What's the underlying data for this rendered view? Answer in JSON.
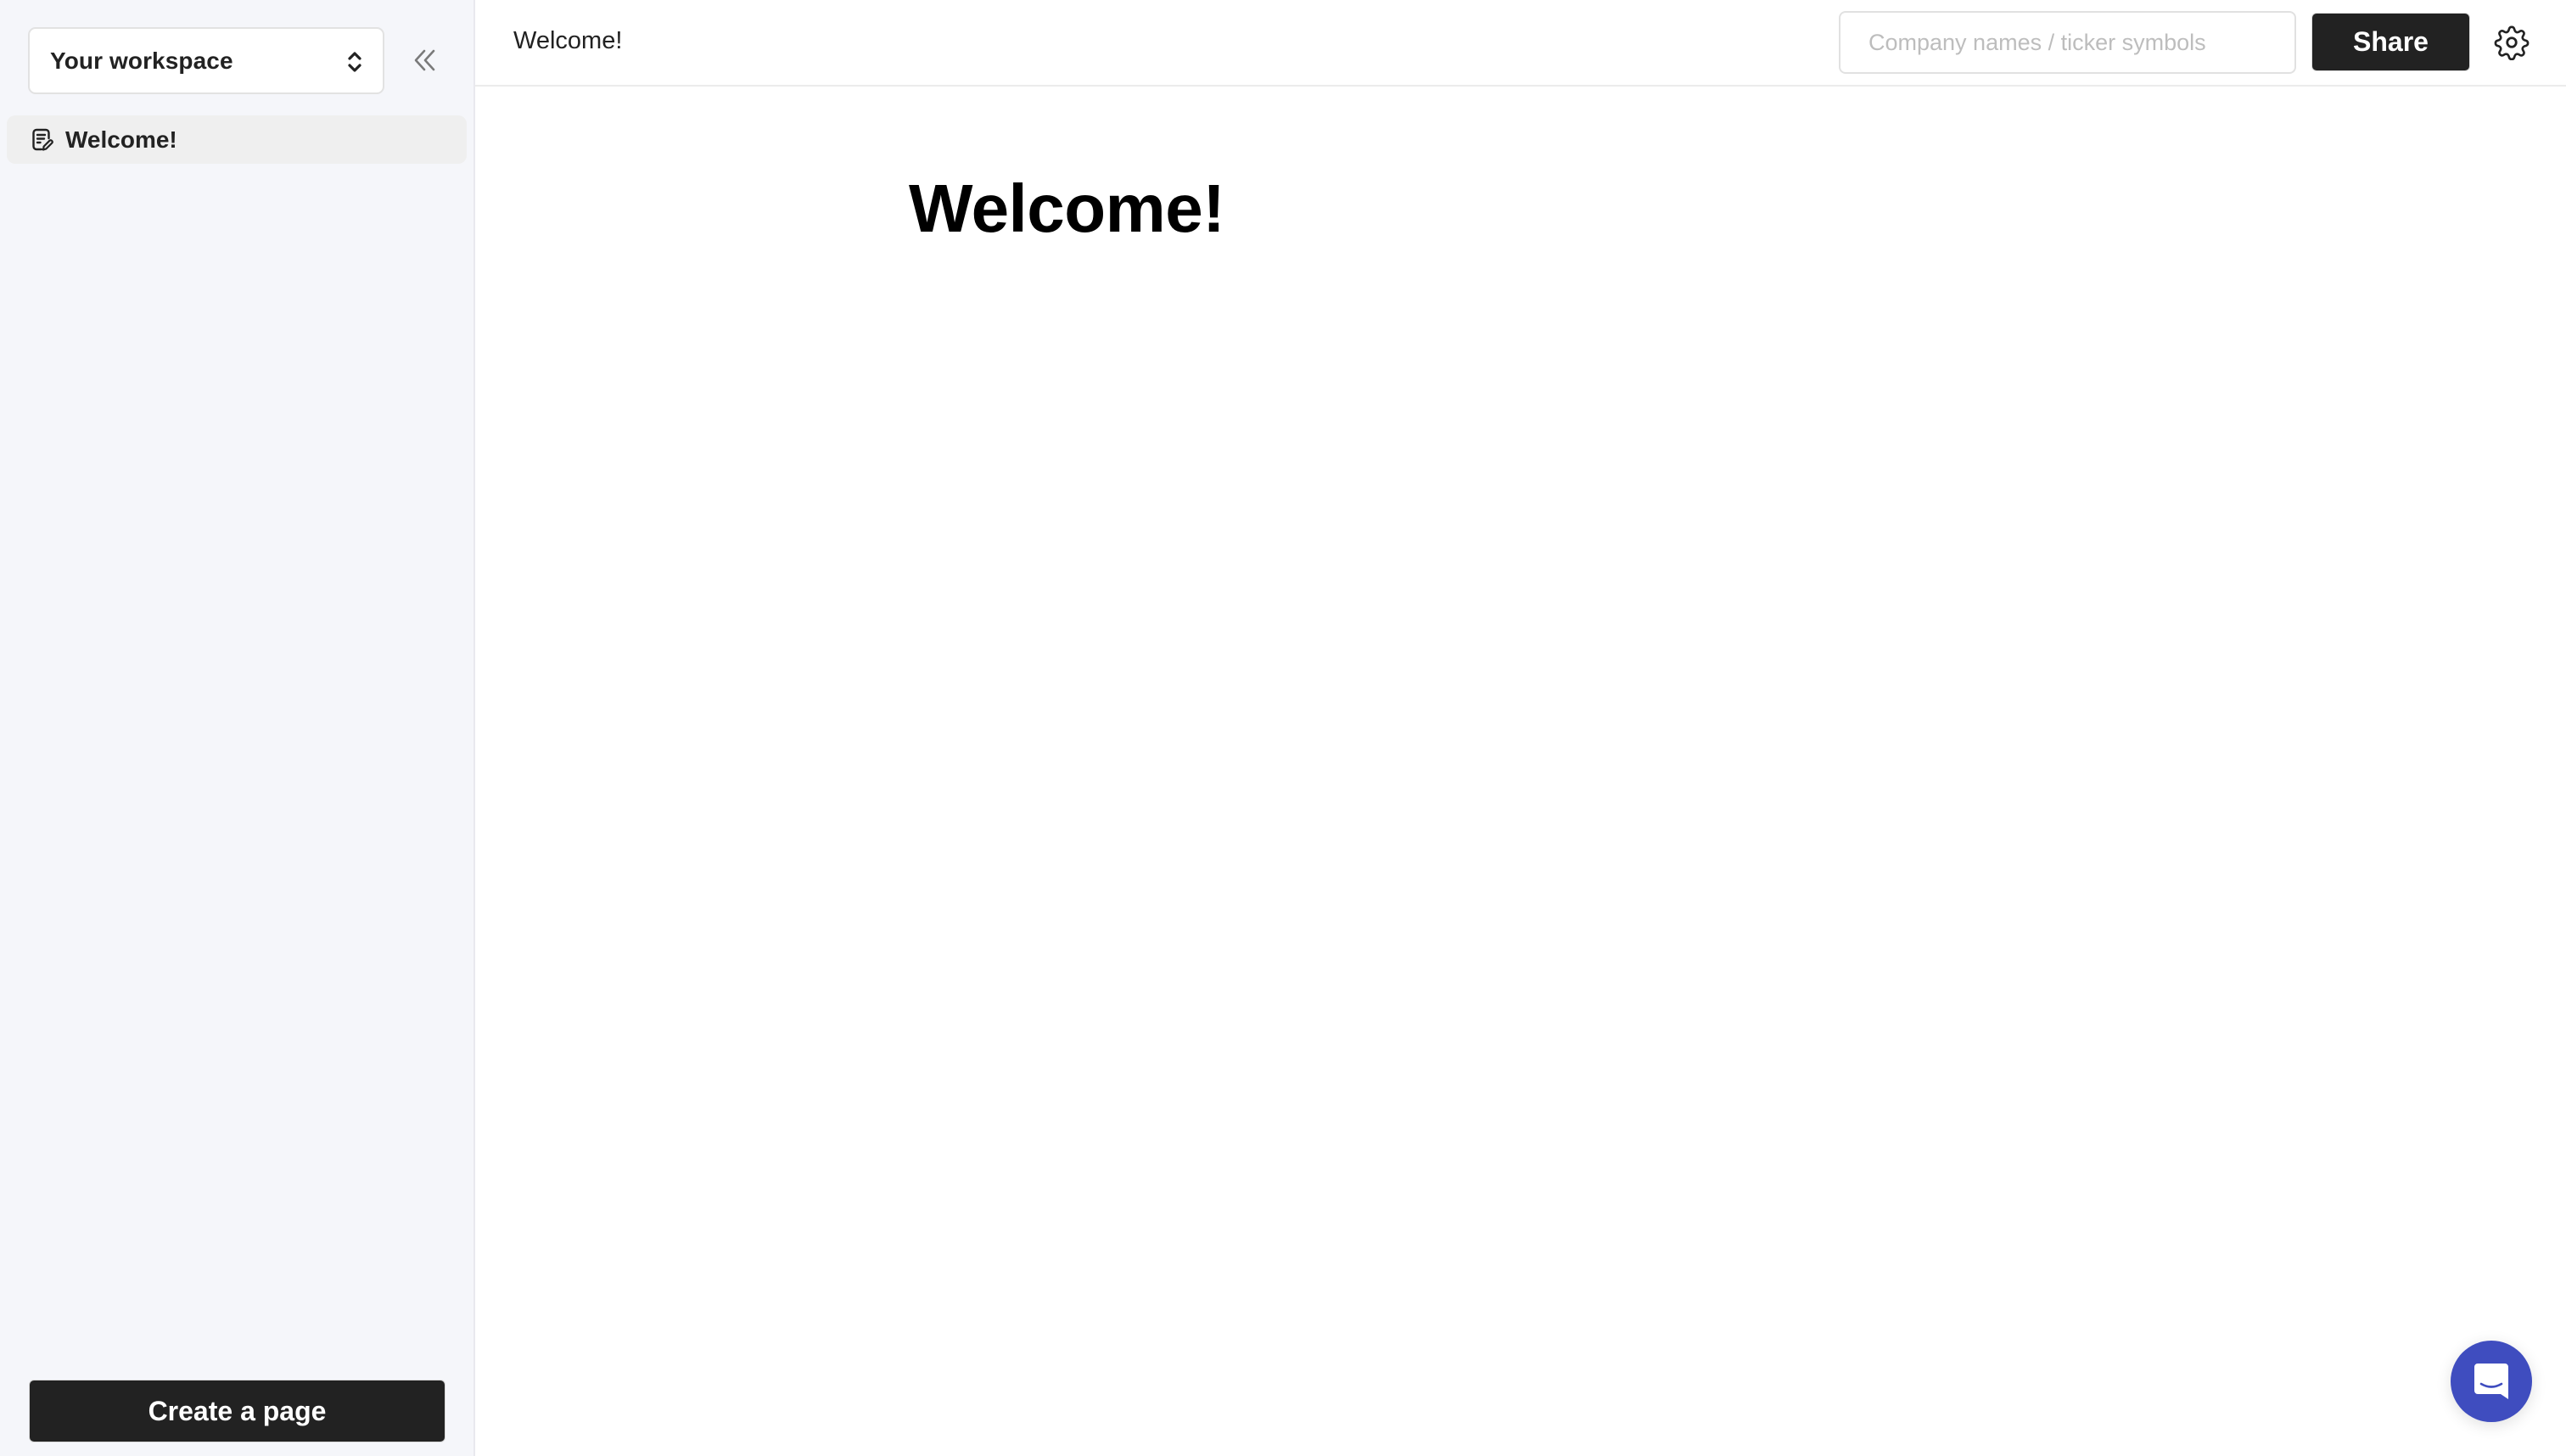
{
  "sidebar": {
    "workspace_label": "Your workspace",
    "workspace_icon": "chevron-up-down-icon",
    "collapse_icon": "double-chevron-left-icon",
    "items": [
      {
        "label": "Welcome!",
        "icon": "note-edit-icon",
        "active": true
      }
    ],
    "create_label": "Create a page"
  },
  "header": {
    "breadcrumb": "Welcome!",
    "search": {
      "placeholder": "Company names / ticker symbols",
      "value": ""
    },
    "share_label": "Share",
    "settings_icon": "gear-icon"
  },
  "main": {
    "title": "Welcome!"
  },
  "chat": {
    "icon": "chat-bubble-icon",
    "color": "#3f4dbf"
  },
  "colors": {
    "sidebar_bg": "#f5f6fa",
    "active_item_bg": "#efefef",
    "button_bg": "#222222",
    "accent": "#3f4dbf"
  }
}
